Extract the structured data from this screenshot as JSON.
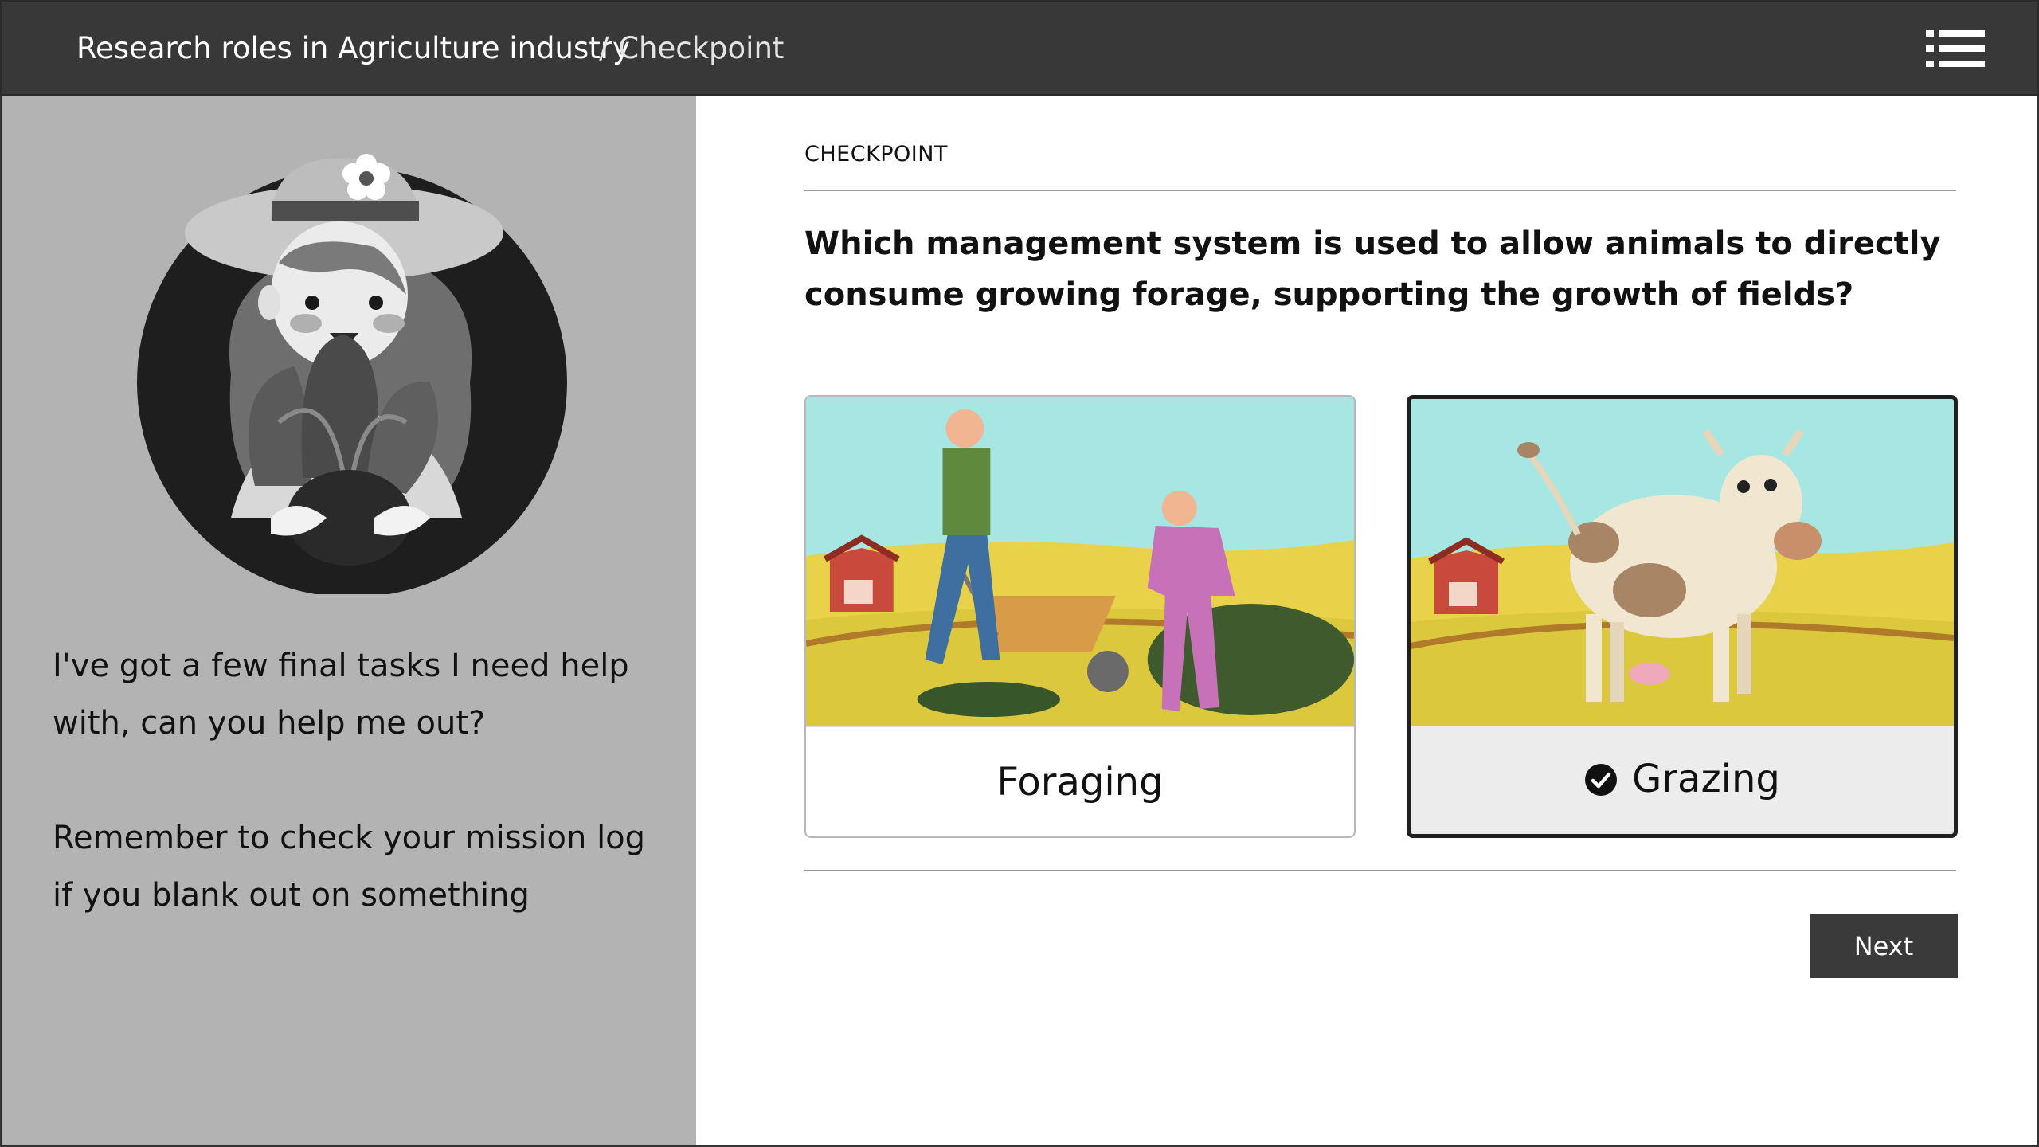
{
  "header": {
    "course_title": "Research roles in Agriculture industry",
    "current_page": "/ Checkpoint",
    "menu_icon": "list-menu-icon"
  },
  "character": {
    "avatar_icon": "farmer-woman-avatar",
    "speech": [
      "I've got a few final tasks I need help with, can you help me out?",
      "Remember to check your mission log if you blank out on something"
    ]
  },
  "checkpoint": {
    "section_label": "CHECKPOINT",
    "question": "Which management system is used to allow animals to directly consume growing forage, supporting the growth of fields?",
    "options": [
      {
        "label": "Foraging",
        "image_icon": "foraging-illustration",
        "selected": false
      },
      {
        "label": "Grazing",
        "image_icon": "grazing-cow-illustration",
        "selected": true,
        "selected_icon": "check-circle-icon"
      }
    ],
    "next_label": "Next"
  },
  "colors": {
    "header_bg": "#383838",
    "left_panel_bg": "#b3b3b3",
    "selected_border": "#1f1f1f",
    "selected_bg": "#ececec",
    "button_bg": "#3a3a3a"
  }
}
